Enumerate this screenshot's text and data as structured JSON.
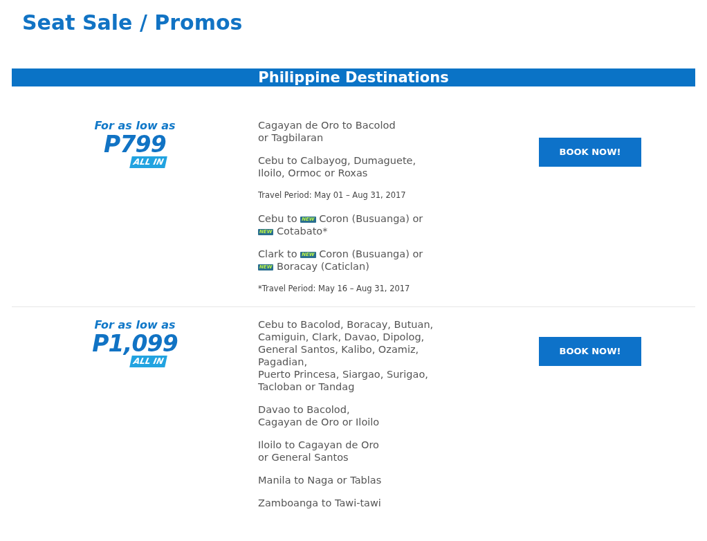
{
  "page_title": "Seat Sale / Promos",
  "banner": "Philippine Destinations",
  "promos": [
    {
      "lead": "For as low as",
      "price": "P799",
      "badge": "ALL IN",
      "button": "BOOK NOW!",
      "blocks": [
        {
          "kind": "route",
          "lines": [
            [
              {
                "kind": "text",
                "text": "Cagayan de Oro to Bacolod"
              }
            ],
            [
              {
                "kind": "text",
                "text": "or Tagbilaran"
              }
            ]
          ]
        },
        {
          "kind": "route",
          "lines": [
            [
              {
                "kind": "text",
                "text": "Cebu to Calbayog, Dumaguete,"
              }
            ],
            [
              {
                "kind": "text",
                "text": "Iloilo, Ormoc or Roxas"
              }
            ]
          ]
        },
        {
          "kind": "note",
          "text": "Travel Period: May 01 – Aug 31, 2017"
        },
        {
          "kind": "route",
          "lines": [
            [
              {
                "kind": "text",
                "text": "Cebu to "
              },
              {
                "kind": "new",
                "text": "NEW"
              },
              {
                "kind": "text",
                "text": " Coron (Busuanga) or"
              }
            ],
            [
              {
                "kind": "new",
                "text": "NEW"
              },
              {
                "kind": "text",
                "text": " Cotabato*"
              }
            ]
          ]
        },
        {
          "kind": "route",
          "lines": [
            [
              {
                "kind": "text",
                "text": "Clark to "
              },
              {
                "kind": "new",
                "text": "NEW"
              },
              {
                "kind": "text",
                "text": " Coron (Busuanga) or"
              }
            ],
            [
              {
                "kind": "new",
                "text": "NEW"
              },
              {
                "kind": "text",
                "text": " Boracay (Caticlan)"
              }
            ]
          ]
        },
        {
          "kind": "note",
          "text": "*Travel Period: May 16 – Aug 31, 2017"
        }
      ]
    },
    {
      "lead": "For as low as",
      "price": "P1,099",
      "badge": "ALL IN",
      "button": "BOOK NOW!",
      "blocks": [
        {
          "kind": "route",
          "lines": [
            [
              {
                "kind": "text",
                "text": "Cebu to Bacolod, Boracay, Butuan,"
              }
            ],
            [
              {
                "kind": "text",
                "text": "Camiguin, Clark, Davao, Dipolog,"
              }
            ],
            [
              {
                "kind": "text",
                "text": "General Santos, Kalibo, Ozamiz,"
              }
            ],
            [
              {
                "kind": "text",
                "text": "Pagadian,"
              }
            ],
            [
              {
                "kind": "text",
                "text": "Puerto Princesa, Siargao, Surigao,"
              }
            ],
            [
              {
                "kind": "text",
                "text": "Tacloban or Tandag"
              }
            ]
          ]
        },
        {
          "kind": "route",
          "lines": [
            [
              {
                "kind": "text",
                "text": "Davao to Bacolod,"
              }
            ],
            [
              {
                "kind": "text",
                "text": "Cagayan de Oro or Iloilo"
              }
            ]
          ]
        },
        {
          "kind": "route",
          "lines": [
            [
              {
                "kind": "text",
                "text": "Iloilo to Cagayan de Oro"
              }
            ],
            [
              {
                "kind": "text",
                "text": "or General Santos"
              }
            ]
          ]
        },
        {
          "kind": "route",
          "lines": [
            [
              {
                "kind": "text",
                "text": "Manila to Naga or Tablas"
              }
            ]
          ]
        },
        {
          "kind": "route",
          "lines": [
            [
              {
                "kind": "text",
                "text": "Zamboanga to Tawi-tawi"
              }
            ]
          ]
        }
      ]
    }
  ]
}
